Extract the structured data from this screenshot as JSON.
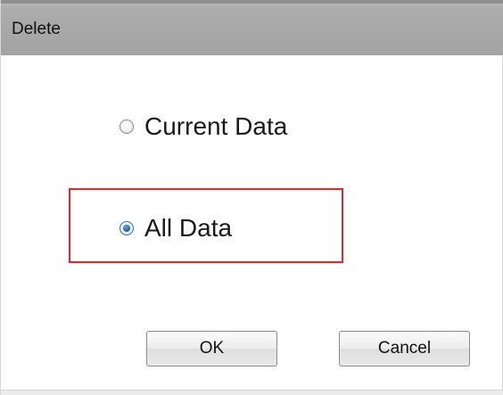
{
  "dialog": {
    "title": "Delete"
  },
  "options": [
    {
      "label": "Current Data",
      "selected": false
    },
    {
      "label": "All Data",
      "selected": true
    }
  ],
  "buttons": {
    "ok_label": "OK",
    "cancel_label": "Cancel"
  },
  "colors": {
    "title_bar": "#a8a8a8",
    "highlight_border": "#e3262f",
    "radio_selected": "#1f5f9e"
  }
}
